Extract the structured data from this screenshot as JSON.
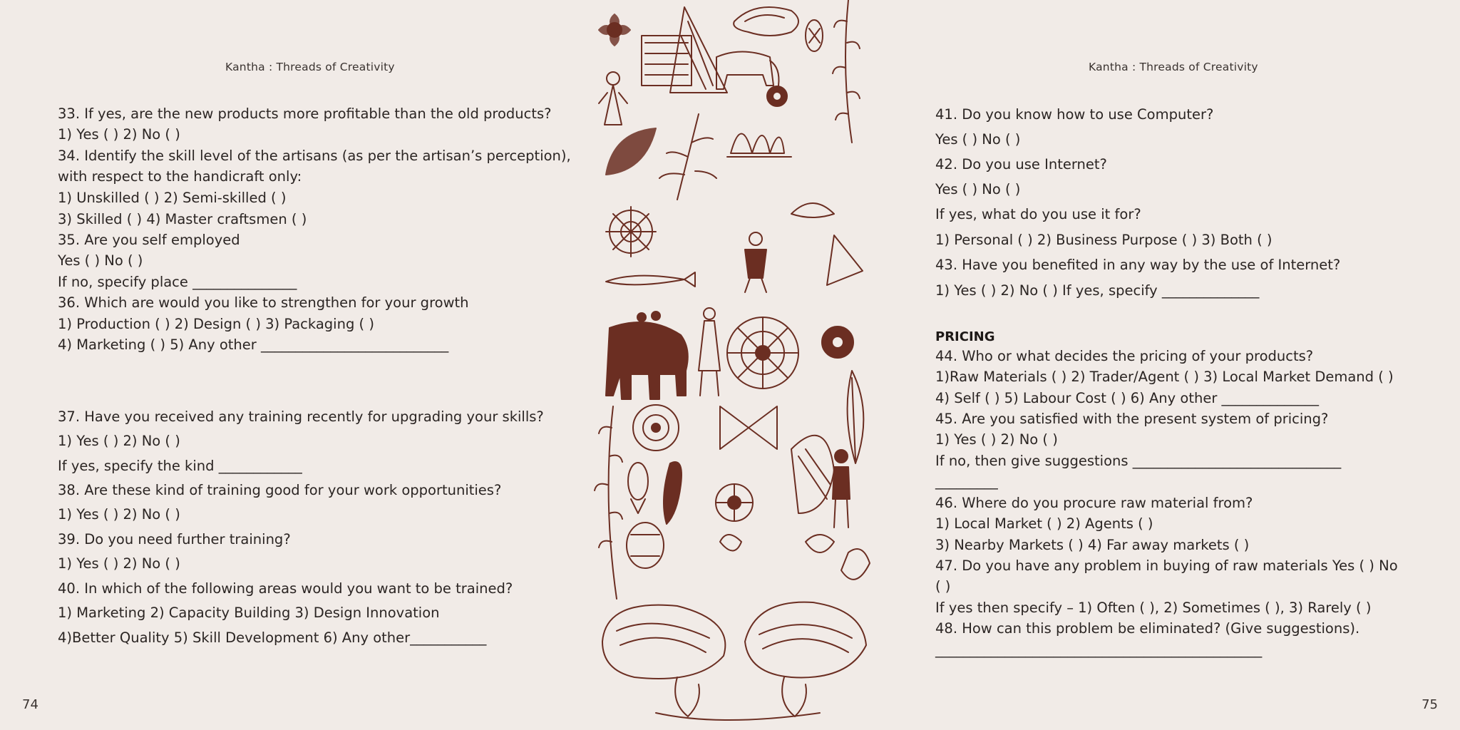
{
  "left_page": {
    "running_head": "Kantha : Threads of Creativity",
    "page_number": "74",
    "lines": [
      "33. If yes, are the new products more profitable than the old products?",
      " 1) Yes ( ) 2) No ( )",
      "34. Identify the skill level of the artisans (as per the artisan’s perception),",
      "with respect to the handicraft only:",
      " 1) Unskilled ( ) 2) Semi-skilled ( )",
      " 3) Skilled ( ) 4) Master craftsmen ( )",
      "35. Are you self employed",
      "Yes ( ) No ( )",
      " If no, specify place _______________",
      "36. Which are would you like to strengthen for your growth",
      "1) Production ( ) 2) Design ( ) 3) Packaging ( )",
      "4) Marketing ( ) 5) Any other ___________________________",
      "37. Have you received any training recently for upgrading your skills?",
      " 1) Yes ( ) 2) No ( )",
      " If yes, specify the kind ____________",
      "38. Are these kind of training good for your work opportunities?",
      " 1) Yes ( ) 2) No ( )",
      "39. Do you need further training?",
      "1) Yes ( ) 2) No ( )",
      "40. In which of the following areas would you want to be trained?",
      " 1) Marketing 2) Capacity Building 3) Design Innovation",
      " 4)Better Quality 5) Skill Development 6) Any other___________"
    ]
  },
  "right_page": {
    "running_head": "Kantha : Threads of Creativity",
    "page_number": "75",
    "section_heading": "PRICING",
    "lines_before": [
      "41. Do you know how to use Computer?",
      "Yes ( ) No ( )",
      "42. Do you use Internet?",
      " Yes ( ) No ( )",
      "If yes, what do you use it for?",
      " 1) Personal ( ) 2) Business Purpose ( ) 3) Both ( )",
      "43. Have you benefited in any way by the use of Internet?",
      " 1) Yes ( ) 2) No ( ) If yes, specify ______________"
    ],
    "lines_after": [
      "44. Who or what decides the pricing of your products?",
      " 1)Raw Materials ( ) 2) Trader/Agent ( ) 3) Local Market Demand ( )",
      "4) Self ( ) 5) Labour Cost ( ) 6) Any other ______________",
      "45. Are you satisfied with the present system of pricing?",
      " 1) Yes ( ) 2) No ( )",
      "  If  no,  then  give  suggestions  ______________________________",
      "_________",
      "46. Where do you procure raw material from?",
      " 1) Local Market ( ) 2) Agents ( )",
      "3) Nearby Markets ( ) 4) Far away markets ( )",
      "47. Do you have any problem in buying of raw materials Yes ( ) No",
      "( )",
      " If yes then specify – 1) Often ( ), 2) Sometimes ( ), 3) Rarely ( )",
      "48. How can this problem be eliminated? (Give suggestions).",
      "_______________________________________________"
    ]
  },
  "illustration": {
    "ink_color": "#6b2e22",
    "paper_color": "#f1ebe7",
    "motifs": [
      "flower",
      "fish",
      "elephant",
      "horse",
      "lotus",
      "peacock",
      "leaf",
      "sun-wheel",
      "human-figure",
      "paisley",
      "birds"
    ]
  }
}
